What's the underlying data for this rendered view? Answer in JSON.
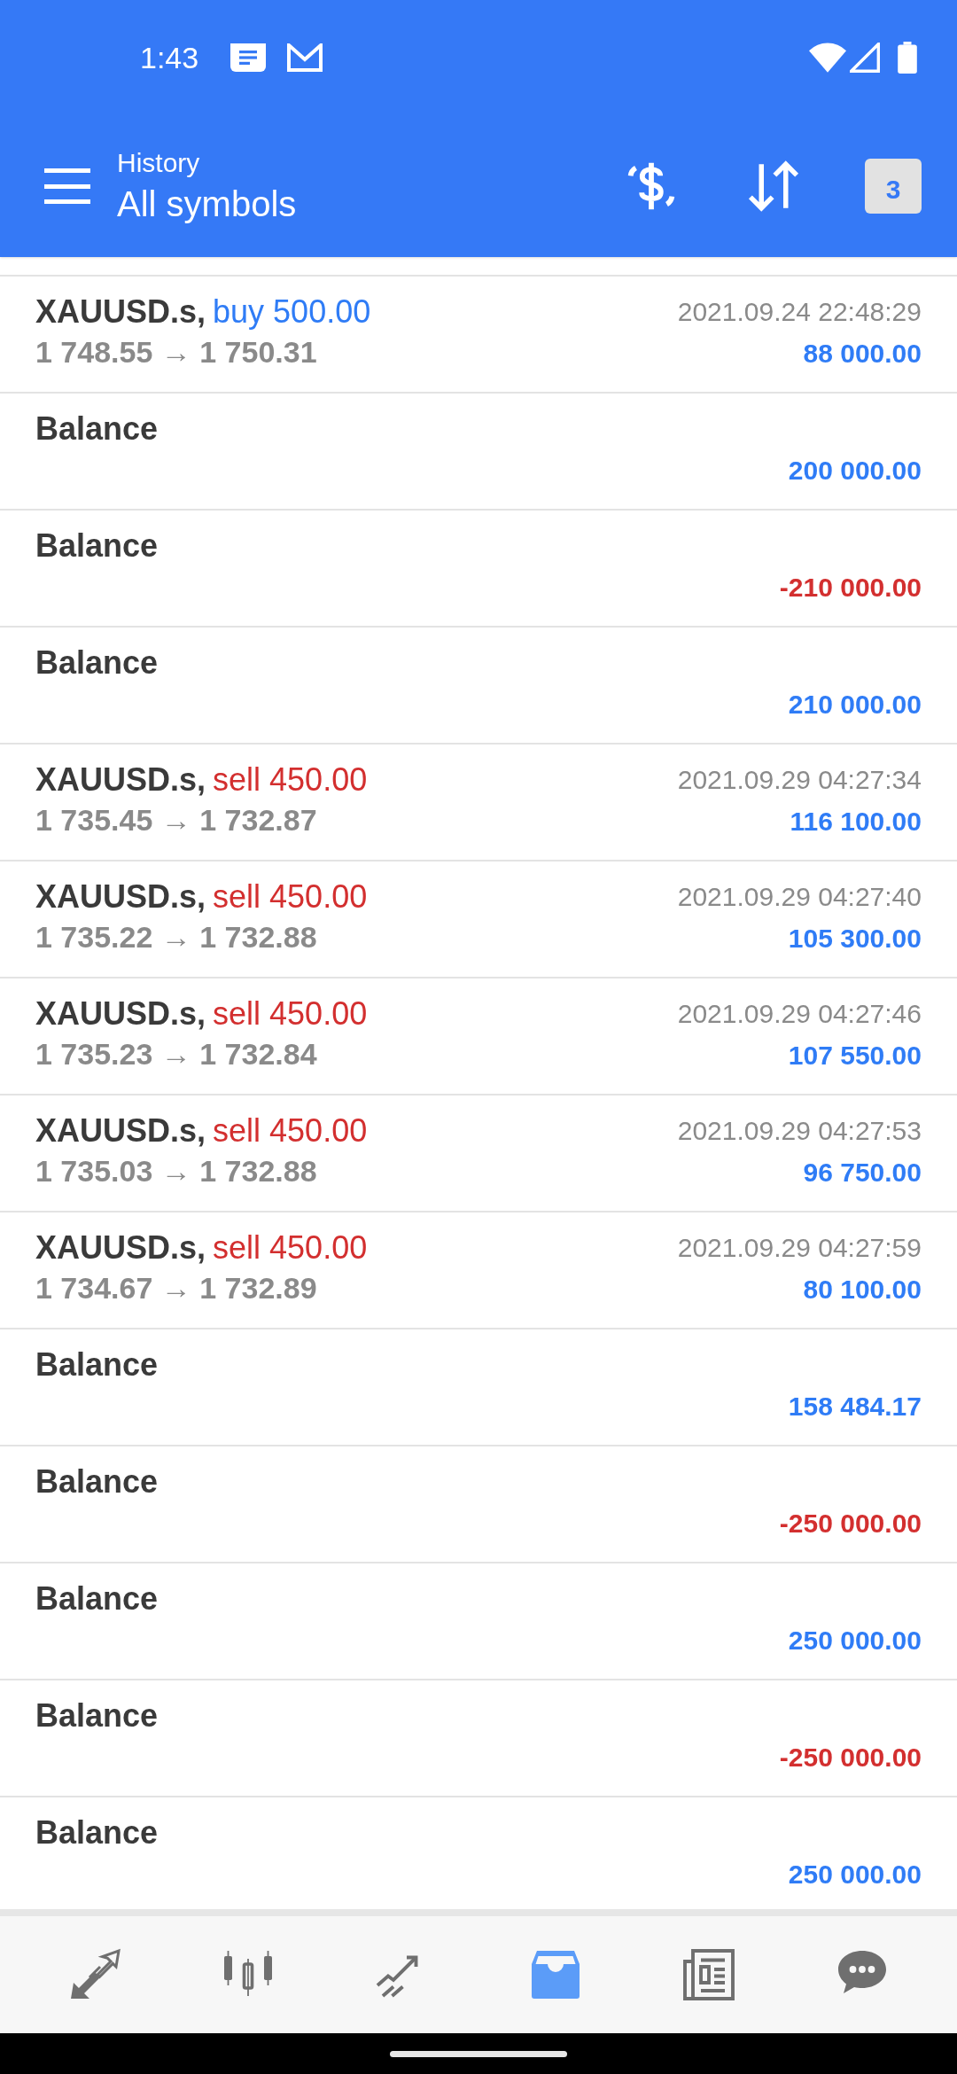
{
  "status_bar": {
    "time": "1:43"
  },
  "app_bar": {
    "subtitle": "History",
    "title": "All symbols",
    "calendar_day": "3"
  },
  "rows": [
    {
      "kind": "buy",
      "symbol": "XAUUSD.s,",
      "action": "buy 500.00",
      "prices": "1 748.55 → 1 750.31",
      "time": "2021.09.24 22:48:29",
      "profit": "88 000.00",
      "negative": false
    },
    {
      "kind": "balance",
      "label": "Balance",
      "profit": "200 000.00",
      "negative": false
    },
    {
      "kind": "balance",
      "label": "Balance",
      "profit": "-210 000.00",
      "negative": true
    },
    {
      "kind": "balance",
      "label": "Balance",
      "profit": "210 000.00",
      "negative": false
    },
    {
      "kind": "sell",
      "symbol": "XAUUSD.s,",
      "action": "sell 450.00",
      "prices": "1 735.45 → 1 732.87",
      "time": "2021.09.29 04:27:34",
      "profit": "116 100.00",
      "negative": false
    },
    {
      "kind": "sell",
      "symbol": "XAUUSD.s,",
      "action": "sell 450.00",
      "prices": "1 735.22 → 1 732.88",
      "time": "2021.09.29 04:27:40",
      "profit": "105 300.00",
      "negative": false
    },
    {
      "kind": "sell",
      "symbol": "XAUUSD.s,",
      "action": "sell 450.00",
      "prices": "1 735.23 → 1 732.84",
      "time": "2021.09.29 04:27:46",
      "profit": "107 550.00",
      "negative": false
    },
    {
      "kind": "sell",
      "symbol": "XAUUSD.s,",
      "action": "sell 450.00",
      "prices": "1 735.03 → 1 732.88",
      "time": "2021.09.29 04:27:53",
      "profit": "96 750.00",
      "negative": false
    },
    {
      "kind": "sell",
      "symbol": "XAUUSD.s,",
      "action": "sell 450.00",
      "prices": "1 734.67 → 1 732.89",
      "time": "2021.09.29 04:27:59",
      "profit": "80 100.00",
      "negative": false
    },
    {
      "kind": "balance",
      "label": "Balance",
      "profit": "158 484.17",
      "negative": false
    },
    {
      "kind": "balance",
      "label": "Balance",
      "profit": "-250 000.00",
      "negative": true
    },
    {
      "kind": "balance",
      "label": "Balance",
      "profit": "250 000.00",
      "negative": false
    },
    {
      "kind": "balance",
      "label": "Balance",
      "profit": "-250 000.00",
      "negative": true
    },
    {
      "kind": "balance",
      "label": "Balance",
      "profit": "250 000.00",
      "negative": false
    }
  ],
  "bottom_nav": [
    {
      "selected": false
    },
    {
      "selected": false
    },
    {
      "selected": false
    },
    {
      "selected": true
    },
    {
      "selected": false
    },
    {
      "selected": false
    }
  ]
}
